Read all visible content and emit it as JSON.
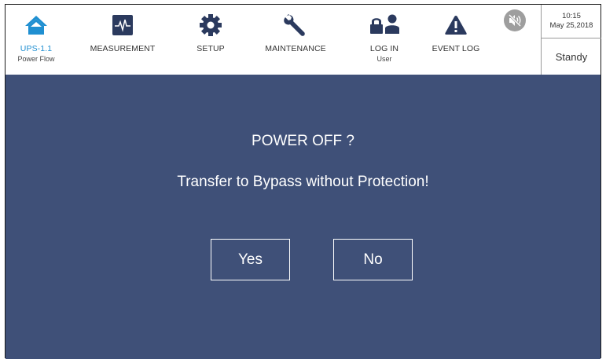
{
  "nav": {
    "home": {
      "label": "UPS-1.1",
      "sublabel": "Power Flow",
      "icon": "home-icon"
    },
    "measurement": {
      "label": "MEASUREMENT",
      "icon": "waveform-icon"
    },
    "setup": {
      "label": "SETUP",
      "icon": "gear-icon"
    },
    "maintenance": {
      "label": "MAINTENANCE",
      "icon": "wrench-icon"
    },
    "login": {
      "label": "LOG IN",
      "sublabel": "User",
      "icon": "lock-user-icon"
    },
    "eventlog": {
      "label": "EVENT LOG",
      "icon": "warning-icon"
    },
    "mute": {
      "icon": "speaker-muted-icon"
    }
  },
  "status": {
    "time": "10:15",
    "date": "May 25,2018",
    "mode": "Standy"
  },
  "dialog": {
    "title": "POWER OFF ?",
    "message": "Transfer to Bypass without Protection!",
    "yes_label": "Yes",
    "no_label": "No"
  },
  "colors": {
    "accent": "#1f8fd1",
    "dialog_bg": "#3f5078",
    "icon_dark": "#2b3a5e"
  }
}
